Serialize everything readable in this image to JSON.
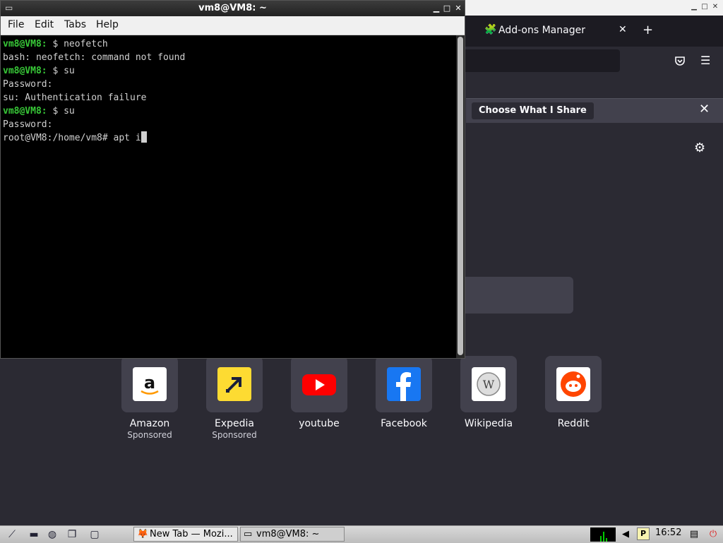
{
  "firefox": {
    "tab_label": "Add-ons Manager",
    "tab_icon": "puzzle-icon",
    "new_tab_symbol": "+",
    "close_symbol": "✕",
    "notice_button": "Choose What I Share",
    "top_sites": [
      {
        "name": "Amazon",
        "sponsor": "Sponsored",
        "icon": "amazon-logo",
        "color": "#ffffff"
      },
      {
        "name": "Expedia",
        "sponsor": "Sponsored",
        "icon": "expedia-logo",
        "color": "#fddb32"
      },
      {
        "name": "youtube",
        "sponsor": "",
        "icon": "youtube-logo",
        "color": "#ff0000"
      },
      {
        "name": "Facebook",
        "sponsor": "",
        "icon": "facebook-logo",
        "color": "#1877f2"
      },
      {
        "name": "Wikipedia",
        "sponsor": "",
        "icon": "wikipedia-logo",
        "color": "#ffffff"
      },
      {
        "name": "Reddit",
        "sponsor": "",
        "icon": "reddit-logo",
        "color": "#ff4500"
      }
    ]
  },
  "terminal": {
    "title": "vm8@VM8: ~",
    "menu": [
      "File",
      "Edit",
      "Tabs",
      "Help"
    ],
    "lines": [
      {
        "prompt": "vm8@VM8:",
        "text": " $ neofetch"
      },
      {
        "prompt": "",
        "text": "bash: neofetch: command not found"
      },
      {
        "prompt": "vm8@VM8:",
        "text": " $ su"
      },
      {
        "prompt": "",
        "text": "Password:"
      },
      {
        "prompt": "",
        "text": "su: Authentication failure"
      },
      {
        "prompt": "vm8@VM8:",
        "text": " $ su"
      },
      {
        "prompt": "",
        "text": "Password:"
      },
      {
        "prompt": "",
        "text": "root@VM8:/home/vm8# apt i"
      }
    ]
  },
  "taskbar": {
    "tasks": [
      {
        "label": "New Tab — Mozi...",
        "icon": "firefox-icon"
      },
      {
        "label": "vm8@VM8: ~",
        "icon": "terminal-icon"
      }
    ],
    "clock": "16:52"
  }
}
